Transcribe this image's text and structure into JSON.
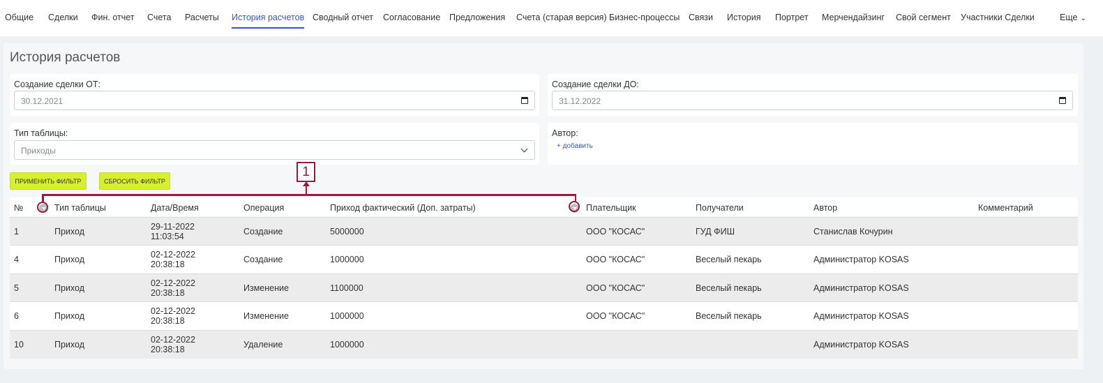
{
  "nav": {
    "tabs": [
      "Общие",
      "Сделки",
      "Фин. отчет",
      "Счета",
      "Расчеты",
      "История расчетов",
      "Сводный отчет",
      "Согласование",
      "Предложения",
      "Счета (старая версия)",
      "Бизнес-процессы",
      "Связи",
      "История",
      "Портрет",
      "Мерчендайзинг",
      "Свой сегмент",
      "Участники Сделки"
    ],
    "more": "Еще",
    "active": "История расчетов"
  },
  "page": {
    "title": "История расчетов"
  },
  "filters": {
    "from_label": "Создание сделки ОТ:",
    "from_value": "30.12.2021",
    "to_label": "Создание сделки ДО:",
    "to_value": "31.12.2022",
    "type_label": "Тип таблицы:",
    "type_value": "Приходы",
    "author_label": "Автор:",
    "author_add": "+ добавить"
  },
  "buttons": {
    "apply": "Применить фильтр",
    "reset": "Сбросить фильтр"
  },
  "callout": {
    "label": "1"
  },
  "table": {
    "headers": {
      "num": "№",
      "type": "Тип таблицы",
      "datetime": "Дата/Время",
      "operation": "Операция",
      "amount": "Приход фактический (Доп. затраты)",
      "payer": "Плательщик",
      "recipients": "Получатели",
      "author": "Автор",
      "comment": "Комментарий"
    },
    "rows": [
      {
        "num": "1",
        "type": "Приход",
        "date": "29-11-2022",
        "time": "11:03:54",
        "operation": "Создание",
        "amount": "5000000",
        "payer": "ООО \"КОСАС\"",
        "recipients": "ГУД ФИШ",
        "author": "Станислав Кочурин",
        "comment": ""
      },
      {
        "num": "4",
        "type": "Приход",
        "date": "02-12-2022",
        "time": "20:38:18",
        "operation": "Создание",
        "amount": "1000000",
        "payer": "ООО \"КОСАС\"",
        "recipients": "Веселый пекарь",
        "author": "Администратор KOSAS",
        "comment": ""
      },
      {
        "num": "5",
        "type": "Приход",
        "date": "02-12-2022",
        "time": "20:38:18",
        "operation": "Изменение",
        "amount": "1100000",
        "payer": "ООО \"КОСАС\"",
        "recipients": "Веселый пекарь",
        "author": "Администратор KOSAS",
        "comment": ""
      },
      {
        "num": "6",
        "type": "Приход",
        "date": "02-12-2022",
        "time": "20:38:18",
        "operation": "Изменение",
        "amount": "1000000",
        "payer": "ООО \"КОСАС\"",
        "recipients": "Веселый пекарь",
        "author": "Администратор KOSAS",
        "comment": ""
      },
      {
        "num": "10",
        "type": "Приход",
        "date": "02-12-2022",
        "time": "20:38:18",
        "operation": "Удаление",
        "amount": "1000000",
        "payer": "",
        "recipients": "",
        "author": "Администратор KOSAS",
        "comment": ""
      }
    ]
  },
  "colors": {
    "accent": "#3a57b8",
    "button": "#d6ef2f",
    "callout": "#9c1a3e"
  }
}
